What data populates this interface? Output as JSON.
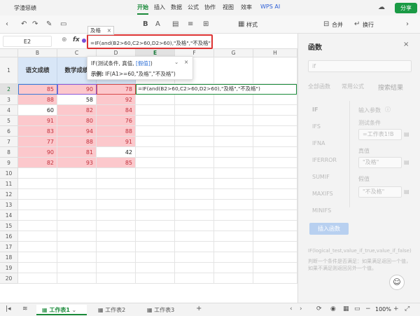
{
  "app": {
    "file_name": "学渣惩绩",
    "menus": [
      "开始",
      "插入",
      "数据",
      "公式",
      "协作",
      "视图",
      "效率",
      "WPS AI"
    ],
    "active_menu": "开始",
    "share_label": "分享"
  },
  "toolbar": {
    "style_label": "样式",
    "merge_label": "合并",
    "wrap_label": "换行"
  },
  "formula_bar": {
    "cell_ref": "E2",
    "fx_label": "fx",
    "formula": "=IF(and(B2>60,C2>60,D2>60),\"及格\",\"不及格\")",
    "suggestion": "及格"
  },
  "tooltip": {
    "signature_prefix": "IF(测试条件, 真值, ",
    "signature_link": "[假值]",
    "signature_suffix": ")",
    "example_label": "示例:",
    "example_value": "IF(A1>=60,\"及格\",\"不及格\")"
  },
  "grid": {
    "columns": [
      "B",
      "C",
      "D",
      "E",
      "F",
      "G",
      "H"
    ],
    "rows": [
      "1",
      "2",
      "3",
      "4",
      "5",
      "6",
      "7",
      "8",
      "9",
      "10",
      "11",
      "12",
      "13",
      "14",
      "15",
      "16",
      "17",
      "18",
      "19",
      "20"
    ],
    "headers": {
      "B1": "语文成绩",
      "C1": "数学成绩"
    },
    "data": [
      [
        "85",
        "90",
        "78"
      ],
      [
        "88",
        "58",
        "92"
      ],
      [
        "60",
        "82",
        "84"
      ],
      [
        "91",
        "80",
        "76"
      ],
      [
        "83",
        "94",
        "88"
      ],
      [
        "77",
        "88",
        "91"
      ],
      [
        "90",
        "81",
        "42"
      ],
      [
        "82",
        "93",
        "85"
      ]
    ],
    "e2_formula": "=IF(and(B2>60,C2>60,D2>60),\"及格\",\"不及格\")",
    "highlight_color": "#fcc8cc",
    "header_color": "#d8e6f7"
  },
  "panel": {
    "title": "函数",
    "search_value": "if",
    "tabs": [
      "全部函数",
      "常用公式",
      "搜索结果"
    ],
    "functions": [
      "IF",
      "IFS",
      "IFNA",
      "IFERROR",
      "SUMIF",
      "MAXIFS",
      "MINIFS"
    ],
    "params_title": "输入参数",
    "param_labels": [
      "测试条件",
      "真值",
      "假值"
    ],
    "param_values": [
      "=工作表1!B",
      "\"及格\"",
      "\"不及格\""
    ],
    "insert_label": "插入函数",
    "syntax": "IF(logical_test,value_if_true,value_if_false)",
    "description": "判断一个条件是否满足：如果满足返回一个值，如果不满足则返回另外一个值。"
  },
  "sheets": [
    "工作表1",
    "工作表2",
    "工作表3"
  ],
  "status": {
    "zoom": "100%"
  }
}
